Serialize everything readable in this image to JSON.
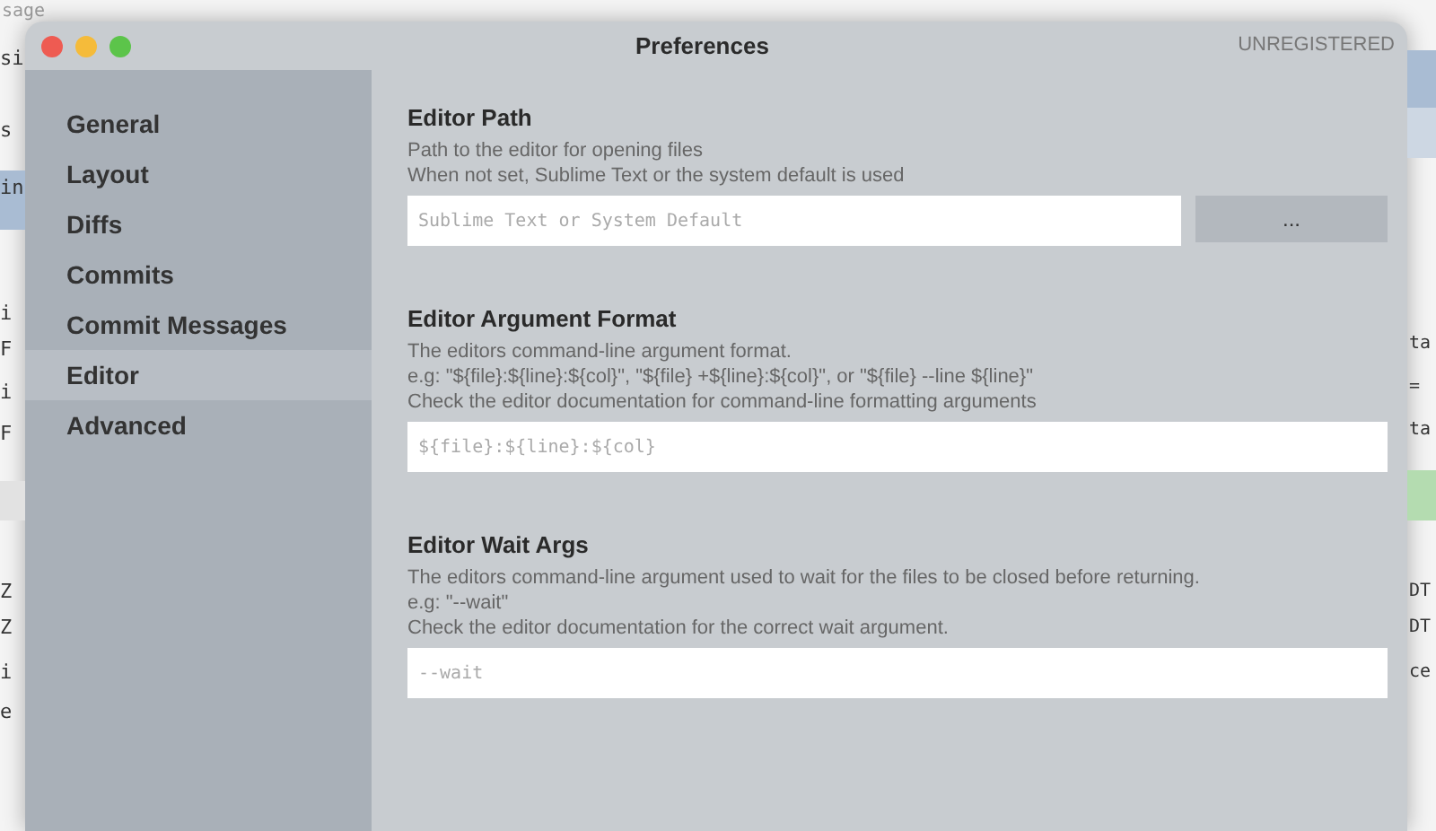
{
  "background": {
    "top_text": "sage",
    "left_fragments": [
      "si",
      "s",
      "in",
      "i",
      "F",
      "i",
      "F",
      "Z",
      "Z",
      "i",
      "e"
    ],
    "right_fragments": [
      "ta",
      "=",
      "ta",
      "DT",
      "DT",
      "ce"
    ]
  },
  "window": {
    "title": "Preferences",
    "badge": "UNREGISTERED"
  },
  "sidebar": {
    "items": [
      {
        "label": "General",
        "selected": false
      },
      {
        "label": "Layout",
        "selected": false
      },
      {
        "label": "Diffs",
        "selected": false
      },
      {
        "label": "Commits",
        "selected": false
      },
      {
        "label": "Commit Messages",
        "selected": false
      },
      {
        "label": "Editor",
        "selected": true
      },
      {
        "label": "Advanced",
        "selected": false
      }
    ]
  },
  "sections": [
    {
      "title": "Editor Path",
      "description": [
        "Path to the editor for opening files",
        "When not set, Sublime Text or the system default is used"
      ],
      "field": {
        "placeholder": "Sublime Text or System Default"
      },
      "button": "..."
    },
    {
      "title": "Editor Argument Format",
      "description": [
        "The editors command-line argument format.",
        "e.g: \"${file}:${line}:${col}\", \"${file} +${line}:${col}\", or \"${file} --line ${line}\"",
        "Check the editor documentation for command-line formatting arguments"
      ],
      "field": {
        "placeholder": "${file}:${line}:${col}"
      }
    },
    {
      "title": "Editor Wait Args",
      "description": [
        "The editors command-line argument used to wait for the files to be closed before returning.",
        "e.g: \"--wait\"",
        "Check the editor documentation for the correct wait argument."
      ],
      "field": {
        "placeholder": "--wait"
      }
    }
  ]
}
